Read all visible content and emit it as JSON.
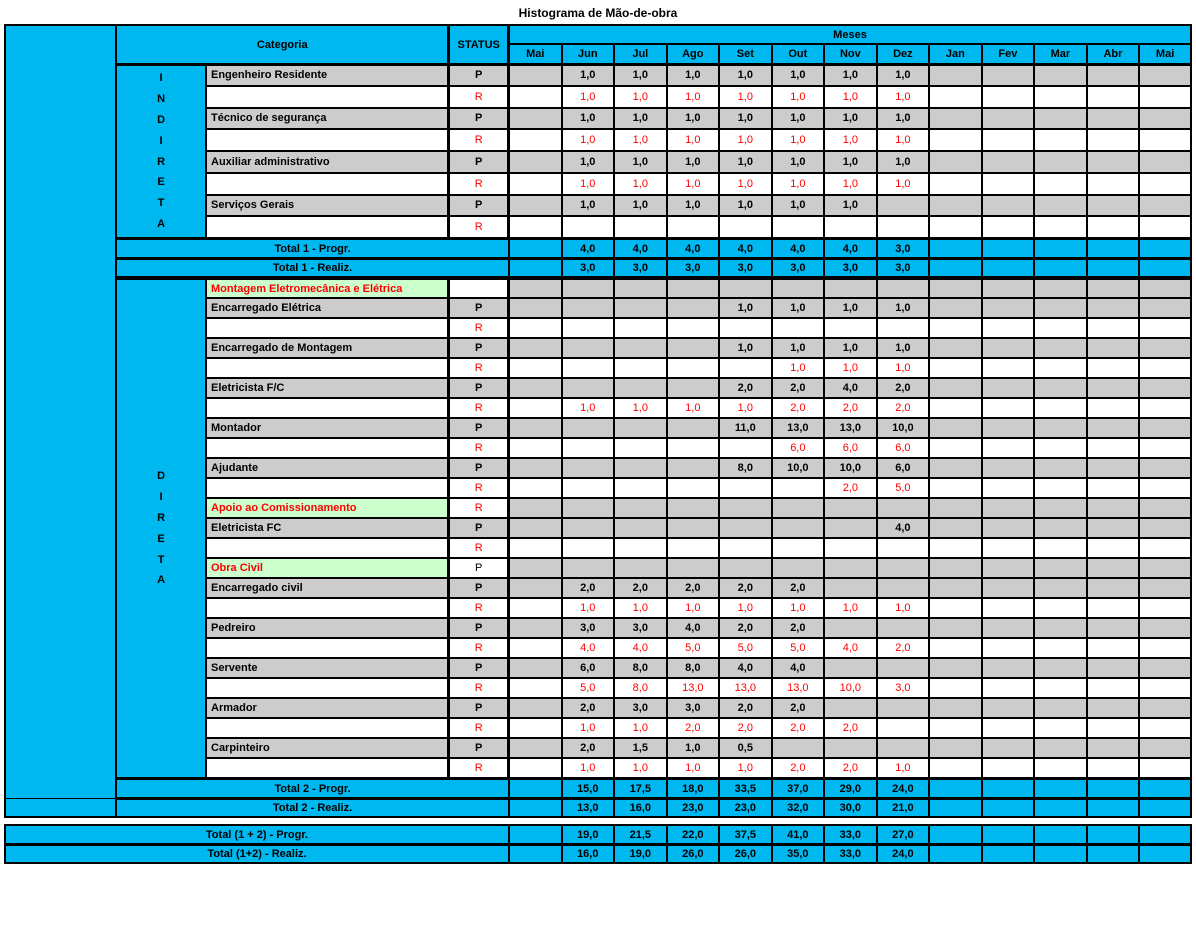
{
  "title": "Histograma de Mão-de-obra",
  "headers": {
    "categoria": "Categoria",
    "status": "STATUS",
    "meses": "Meses",
    "months": [
      "Mai",
      "Jun",
      "Jul",
      "Ago",
      "Set",
      "Out",
      "Nov",
      "Dez",
      "Jan",
      "Fev",
      "Mar",
      "Abr",
      "Mai"
    ]
  },
  "side": {
    "indireta": "INDIRETA",
    "direta": "DIRETA"
  },
  "status": {
    "p": "P",
    "r": "R"
  },
  "indireta": [
    {
      "name": "Engenheiro Residente",
      "p": [
        "",
        "1,0",
        "1,0",
        "1,0",
        "1,0",
        "1,0",
        "1,0",
        "1,0",
        "",
        "",
        "",
        "",
        ""
      ],
      "r": [
        "",
        "1,0",
        "1,0",
        "1,0",
        "1,0",
        "1,0",
        "1,0",
        "1,0",
        "",
        "",
        "",
        "",
        ""
      ]
    },
    {
      "name": "Técnico de segurança",
      "p": [
        "",
        "1,0",
        "1,0",
        "1,0",
        "1,0",
        "1,0",
        "1,0",
        "1,0",
        "",
        "",
        "",
        "",
        ""
      ],
      "r": [
        "",
        "1,0",
        "1,0",
        "1,0",
        "1,0",
        "1,0",
        "1,0",
        "1,0",
        "",
        "",
        "",
        "",
        ""
      ]
    },
    {
      "name": "Auxiliar administrativo",
      "p": [
        "",
        "1,0",
        "1,0",
        "1,0",
        "1,0",
        "1,0",
        "1,0",
        "1,0",
        "",
        "",
        "",
        "",
        ""
      ],
      "r": [
        "",
        "1,0",
        "1,0",
        "1,0",
        "1,0",
        "1,0",
        "1,0",
        "1,0",
        "",
        "",
        "",
        "",
        ""
      ]
    },
    {
      "name": "Serviços Gerais",
      "p": [
        "",
        "1,0",
        "1,0",
        "1,0",
        "1,0",
        "1,0",
        "1,0",
        "",
        "",
        "",
        "",
        "",
        ""
      ],
      "r": [
        "",
        "",
        "",
        "",
        "",
        "",
        "",
        "",
        "",
        "",
        "",
        "",
        ""
      ]
    }
  ],
  "totals1": {
    "prog_label": "Total 1 - Progr.",
    "progr": [
      "",
      "4,0",
      "4,0",
      "4,0",
      "4,0",
      "4,0",
      "4,0",
      "3,0",
      "",
      "",
      "",
      "",
      ""
    ],
    "real_label": "Total 1 - Realiz.",
    "realiz": [
      "",
      "3,0",
      "3,0",
      "3,0",
      "3,0",
      "3,0",
      "3,0",
      "3,0",
      "",
      "",
      "",
      "",
      ""
    ]
  },
  "direta_sections": {
    "s1": "Montagem Eletromecânica e Elétrica",
    "s2": "Apoio ao Comissionamento",
    "s3": "Obra Civil"
  },
  "direta": {
    "enc_eletrica": {
      "name": "Encarregado Elétrica",
      "p": [
        "",
        "",
        "",
        "",
        "1,0",
        "1,0",
        "1,0",
        "1,0",
        "",
        "",
        "",
        "",
        ""
      ],
      "r": [
        "",
        "",
        "",
        "",
        "",
        "",
        "",
        "",
        "",
        "",
        "",
        "",
        ""
      ]
    },
    "enc_montagem": {
      "name": "Encarregado de Montagem",
      "p": [
        "",
        "",
        "",
        "",
        "1,0",
        "1,0",
        "1,0",
        "1,0",
        "",
        "",
        "",
        "",
        ""
      ],
      "r": [
        "",
        "",
        "",
        "",
        "",
        "1,0",
        "1,0",
        "1,0",
        "",
        "",
        "",
        "",
        ""
      ]
    },
    "eletricista_fc": {
      "name": "Eletricista F/C",
      "p": [
        "",
        "",
        "",
        "",
        "2,0",
        "2,0",
        "4,0",
        "2,0",
        "",
        "",
        "",
        "",
        ""
      ],
      "r": [
        "",
        "1,0",
        "1,0",
        "1,0",
        "1,0",
        "2,0",
        "2,0",
        "2,0",
        "",
        "",
        "",
        "",
        ""
      ]
    },
    "montador": {
      "name": "Montador",
      "p": [
        "",
        "",
        "",
        "",
        "11,0",
        "13,0",
        "13,0",
        "10,0",
        "",
        "",
        "",
        "",
        ""
      ],
      "r": [
        "",
        "",
        "",
        "",
        "",
        "6,0",
        "6,0",
        "6,0",
        "",
        "",
        "",
        "",
        ""
      ]
    },
    "ajudante": {
      "name": "Ajudante",
      "p": [
        "",
        "",
        "",
        "",
        "8,0",
        "10,0",
        "10,0",
        "6,0",
        "",
        "",
        "",
        "",
        ""
      ],
      "r": [
        "",
        "",
        "",
        "",
        "",
        "",
        "2,0",
        "5,0",
        "",
        "",
        "",
        "",
        ""
      ]
    },
    "eletricista_fc2": {
      "name": "Eletricista FC",
      "p": [
        "",
        "",
        "",
        "",
        "",
        "",
        "",
        "4,0",
        "",
        "",
        "",
        "",
        ""
      ],
      "r": [
        "",
        "",
        "",
        "",
        "",
        "",
        "",
        "",
        "",
        "",
        "",
        "",
        ""
      ]
    },
    "enc_civil": {
      "name": "Encarregado civil",
      "p": [
        "",
        "2,0",
        "2,0",
        "2,0",
        "2,0",
        "2,0",
        "",
        "",
        "",
        "",
        "",
        "",
        ""
      ],
      "r": [
        "",
        "1,0",
        "1,0",
        "1,0",
        "1,0",
        "1,0",
        "1,0",
        "1,0",
        "",
        "",
        "",
        "",
        ""
      ]
    },
    "pedreiro": {
      "name": "Pedreiro",
      "p": [
        "",
        "3,0",
        "3,0",
        "4,0",
        "2,0",
        "2,0",
        "",
        "",
        "",
        "",
        "",
        "",
        ""
      ],
      "r": [
        "",
        "4,0",
        "4,0",
        "5,0",
        "5,0",
        "5,0",
        "4,0",
        "2,0",
        "",
        "",
        "",
        "",
        ""
      ]
    },
    "servente": {
      "name": "Servente",
      "p": [
        "",
        "6,0",
        "8,0",
        "8,0",
        "4,0",
        "4,0",
        "",
        "",
        "",
        "",
        "",
        "",
        ""
      ],
      "r": [
        "",
        "5,0",
        "8,0",
        "13,0",
        "13,0",
        "13,0",
        "10,0",
        "3,0",
        "",
        "",
        "",
        "",
        ""
      ]
    },
    "armador": {
      "name": "Armador",
      "p": [
        "",
        "2,0",
        "3,0",
        "3,0",
        "2,0",
        "2,0",
        "",
        "",
        "",
        "",
        "",
        "",
        ""
      ],
      "r": [
        "",
        "1,0",
        "1,0",
        "2,0",
        "2,0",
        "2,0",
        "2,0",
        "",
        "",
        "",
        "",
        "",
        ""
      ]
    },
    "carpinteiro": {
      "name": "Carpinteiro",
      "p": [
        "",
        "2,0",
        "1,5",
        "1,0",
        "0,5",
        "",
        "",
        "",
        "",
        "",
        "",
        "",
        ""
      ],
      "r": [
        "",
        "1,0",
        "1,0",
        "1,0",
        "1,0",
        "2,0",
        "2,0",
        "1,0",
        "",
        "",
        "",
        "",
        ""
      ]
    }
  },
  "totals2": {
    "prog_label": "Total 2 - Progr.",
    "progr": [
      "",
      "15,0",
      "17,5",
      "18,0",
      "33,5",
      "37,0",
      "29,0",
      "24,0",
      "",
      "",
      "",
      "",
      ""
    ],
    "real_label": "Total 2 - Realiz.",
    "realiz": [
      "",
      "13,0",
      "16,0",
      "23,0",
      "23,0",
      "32,0",
      "30,0",
      "21,0",
      "",
      "",
      "",
      "",
      ""
    ]
  },
  "grand": {
    "prog_label": "Total (1 + 2) - Progr.",
    "progr": [
      "",
      "19,0",
      "21,5",
      "22,0",
      "37,5",
      "41,0",
      "33,0",
      "27,0",
      "",
      "",
      "",
      "",
      ""
    ],
    "real_label": "Total (1+2) - Realiz.",
    "realiz": [
      "",
      "16,0",
      "19,0",
      "26,0",
      "26,0",
      "35,0",
      "33,0",
      "24,0",
      "",
      "",
      "",
      "",
      ""
    ]
  }
}
